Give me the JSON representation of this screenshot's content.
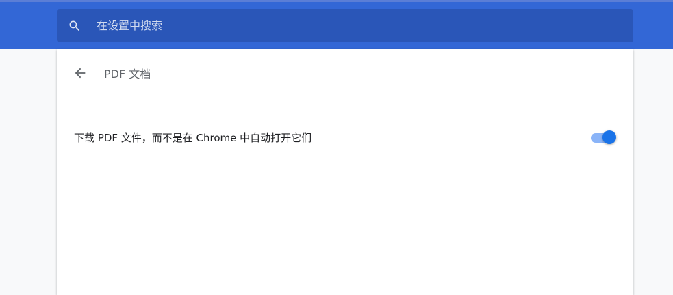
{
  "colors": {
    "header_bg": "#3367d6",
    "search_bg": "#2a56b8",
    "accent": "#1a73e8",
    "toggle_track": "#8ab4f8"
  },
  "search": {
    "icon": "search-icon",
    "placeholder": "在设置中搜索",
    "value": ""
  },
  "subpage": {
    "back_icon": "arrow-back-icon",
    "title": "PDF 文档"
  },
  "settings": {
    "download_pdf": {
      "label": "下载 PDF 文件，而不是在 Chrome 中自动打开它们",
      "enabled": true
    }
  }
}
